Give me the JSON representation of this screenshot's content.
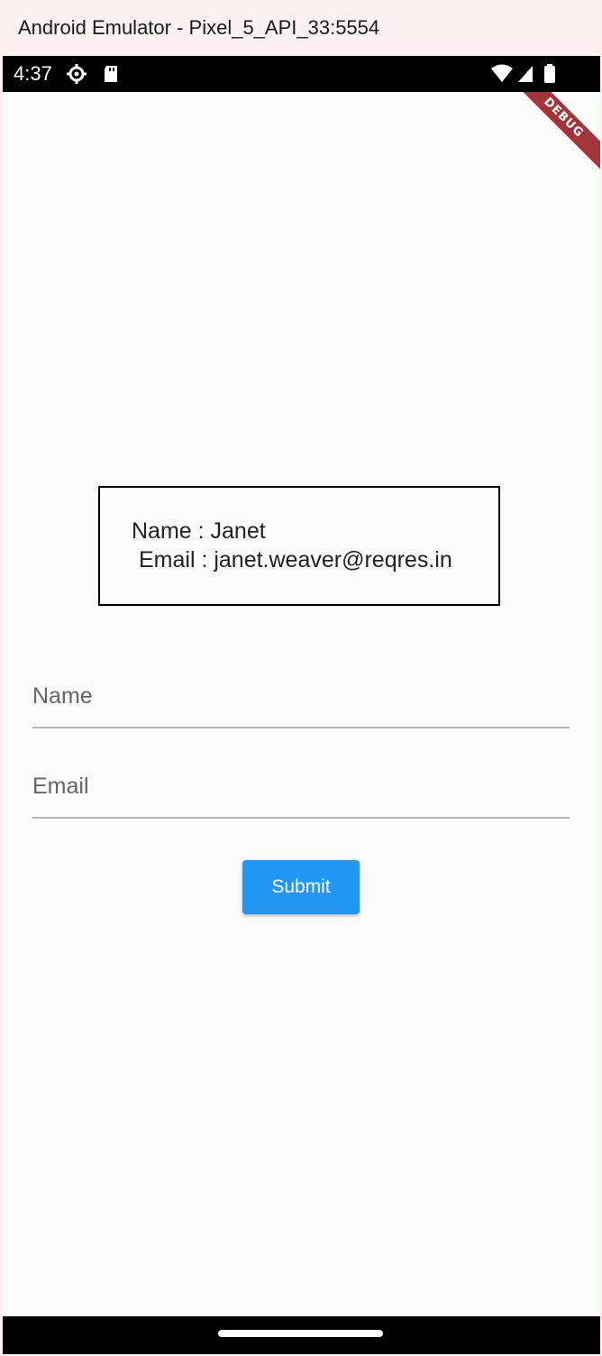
{
  "window": {
    "title": "Android Emulator - Pixel_5_API_33:5554"
  },
  "status_bar": {
    "time": "4:37",
    "icons": [
      "settings-gear-icon",
      "sd-card-icon",
      "wifi-icon",
      "cell-signal-icon",
      "battery-icon"
    ]
  },
  "debug_banner": {
    "label": "DEBUG"
  },
  "user_card": {
    "name_line": "Name : Janet",
    "email_line": "Email : janet.weaver@reqres.in"
  },
  "form": {
    "name_placeholder": "Name",
    "email_placeholder": "Email",
    "submit_label": "Submit"
  },
  "colors": {
    "accent": "#2196f3",
    "debug_banner": "#a3353a",
    "background": "#fafafa"
  }
}
